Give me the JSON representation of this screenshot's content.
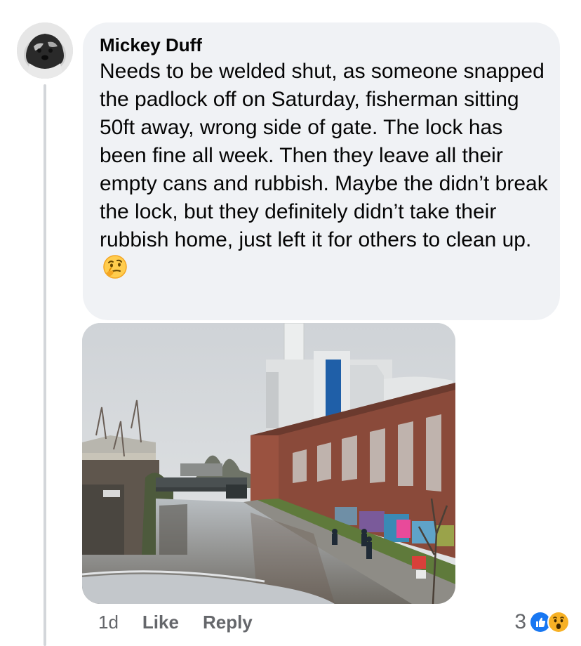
{
  "comment": {
    "author": "Mickey Duff",
    "text": "Needs to be welded shut, as someone snapped the padlock off on Saturday, fisherman sitting 50ft away, wrong side of gate. The lock has been fine all week. Then they leave all their empty cans and rubbish. Maybe the didn’t break the lock, but they definitely didn’t take their rubbish home, just left it for others to clean up.",
    "emoji": "thinking-face-icon",
    "avatar_icon": "dog-avatar",
    "photo": "canal-photo",
    "timestamp": "1d",
    "like_label": "Like",
    "reply_label": "Reply",
    "reaction_count": "3",
    "reactions": [
      "like-icon",
      "wow-icon"
    ]
  },
  "colors": {
    "bubble_bg": "#f0f2f5",
    "text": "#050505",
    "secondary_text": "#65676b",
    "like_blue": "#1877f2",
    "wow_yellow": "#f7b125"
  }
}
